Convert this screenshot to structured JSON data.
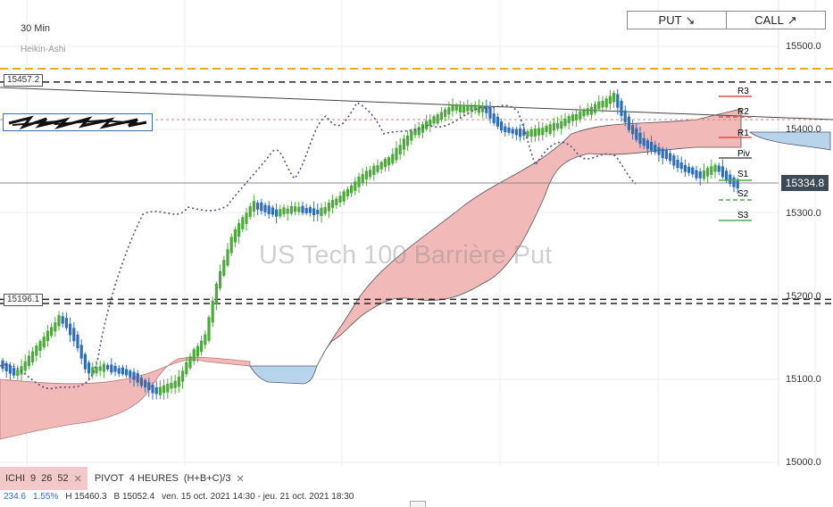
{
  "window": {
    "title": "US Tech 100 Barrière Put"
  },
  "header": {
    "timeframe": "30 Min",
    "candle_type": "Heikin-Ashi"
  },
  "trade_buttons": {
    "put_label": "PUT",
    "put_icon": "arrow-down-right-icon",
    "call_label": "CALL",
    "call_icon": "arrow-up-right-icon"
  },
  "watermark": "US Tech 100 Barrière Put",
  "levels": {
    "upper": "15457.2",
    "lower": "15196.1"
  },
  "current_price": "15334.8",
  "axis": {
    "ticks": [
      "15500.0",
      "15400.0",
      "15300.0",
      "15200.0",
      "15100.0",
      "15000.0"
    ]
  },
  "pivots": [
    {
      "name": "R3",
      "color": "#d9534f"
    },
    {
      "name": "R2",
      "color": "#d9534f"
    },
    {
      "name": "R1",
      "color": "#d9534f"
    },
    {
      "name": "Piv",
      "color": "#555555"
    },
    {
      "name": "S1",
      "color": "#4caf50"
    },
    {
      "name": "S2",
      "color": "#4caf50"
    },
    {
      "name": "S3",
      "color": "#4caf50"
    }
  ],
  "indicators": {
    "ichimoku": {
      "name": "ICHI",
      "params": [
        "9",
        "26",
        "52"
      ]
    },
    "pivot": {
      "name": "PIVOT",
      "period": "4 HEURES",
      "formula": "(H+B+C)/3"
    }
  },
  "status": {
    "change": "234.6",
    "change_pct": "1.55%",
    "high": "H 15460.3",
    "low": "B 15052.4",
    "range": "ven. 15 oct. 2021 14:30 - jeu. 21 oct. 2021 18:30"
  },
  "colors": {
    "up_candle": "#4ea83e",
    "down_candle": "#2f6db5",
    "kumo_bull": "#f2b9b9",
    "kumo_bear": "#b8d4ea",
    "dashed_line": "#222222",
    "orange_line": "#f5a623",
    "lagging_span": "#5a4a8a"
  }
}
